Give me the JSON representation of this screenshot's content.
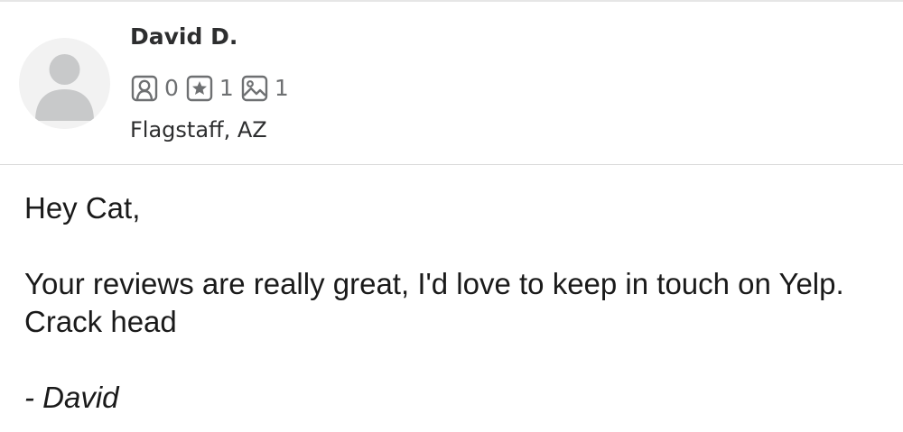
{
  "profile": {
    "name": "David D.",
    "location": "Flagstaff, AZ",
    "stats": {
      "friends": "0",
      "reviews": "1",
      "photos": "1"
    },
    "icons": {
      "avatar": "default-user-silhouette",
      "friends": "friends-icon",
      "reviews": "star-review-icon",
      "photos": "photo-icon"
    }
  },
  "message": {
    "greeting": "Hey Cat,",
    "body": "Your reviews are really great, I'd love to keep in touch on Yelp. Crack head",
    "signature": "- David"
  },
  "colors": {
    "text": "#2d2e2f",
    "muted": "#6e7072",
    "divider": "#d9d9d9",
    "avatar_bg": "#f2f2f2",
    "avatar_fg": "#c8c9ca"
  }
}
